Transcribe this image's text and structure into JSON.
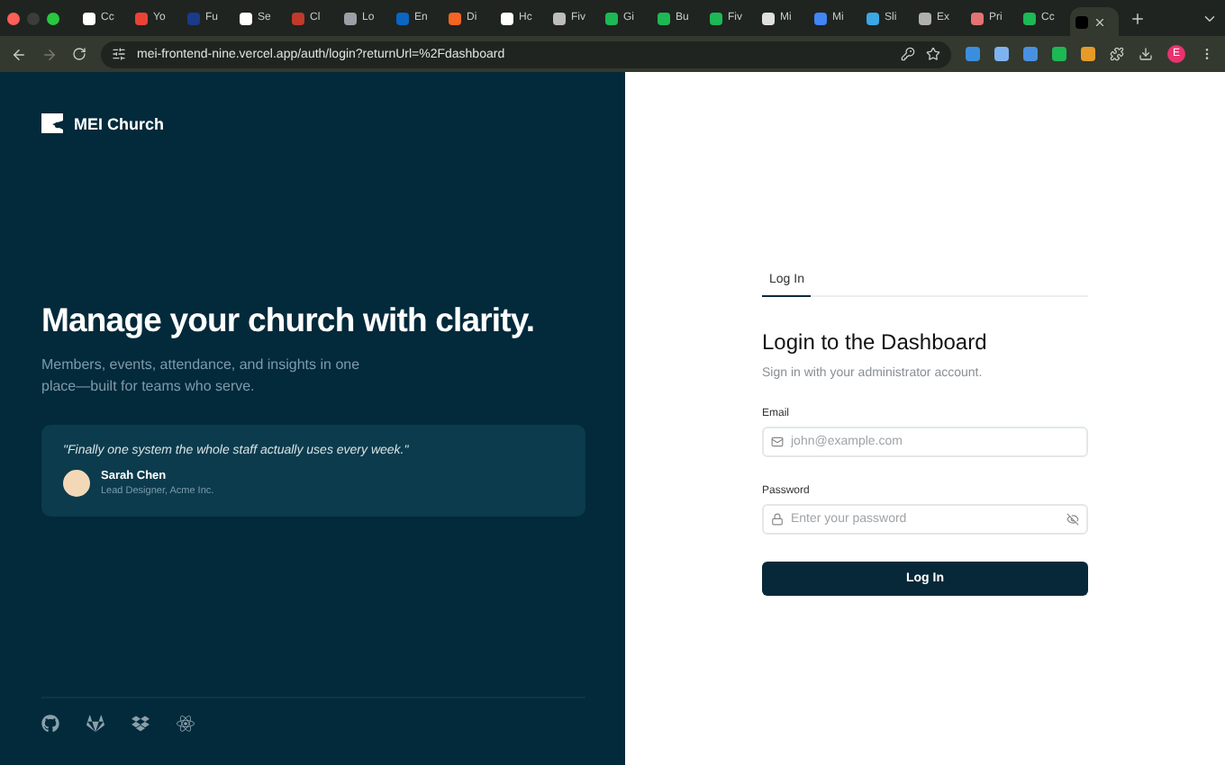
{
  "browser": {
    "tabs": [
      {
        "title": "Cc",
        "color": "#ffffff",
        "selected": false
      },
      {
        "title": "Yo",
        "color": "#ea4335",
        "selected": false
      },
      {
        "title": "Fu",
        "color": "#1a3a8a",
        "selected": false
      },
      {
        "title": "Se",
        "color": "#ffffff",
        "selected": false
      },
      {
        "title": "Cl",
        "color": "#c0392b",
        "selected": false
      },
      {
        "title": "Lo",
        "color": "#9aa0a6",
        "selected": false
      },
      {
        "title": "En",
        "color": "#0a66c2",
        "selected": false
      },
      {
        "title": "Di",
        "color": "#f26522",
        "selected": false
      },
      {
        "title": "Hc",
        "color": "#ffffff",
        "selected": false
      },
      {
        "title": "Fiv",
        "color": "#bdbdbd",
        "selected": false
      },
      {
        "title": "Gi",
        "color": "#1db954",
        "selected": false
      },
      {
        "title": "Bu",
        "color": "#1db954",
        "selected": false
      },
      {
        "title": "Fiv",
        "color": "#1db954",
        "selected": false
      },
      {
        "title": "Mi",
        "color": "#e0e0e0",
        "selected": false
      },
      {
        "title": "Mi",
        "color": "#4285f4",
        "selected": false
      },
      {
        "title": "Sli",
        "color": "#3ba7e5",
        "selected": false
      },
      {
        "title": "Ex",
        "color": "#b0b0b0",
        "selected": false
      },
      {
        "title": "Pri",
        "color": "#e57373",
        "selected": false
      },
      {
        "title": "Cc",
        "color": "#1db954",
        "selected": false
      },
      {
        "color": "#000000",
        "selected": true
      }
    ],
    "url": "mei-frontend-nine.vercel.app/auth/login?returnUrl=%2Fdashboard",
    "profile": "E"
  },
  "brand": {
    "name": "MEI Church"
  },
  "hero": {
    "title": "Manage your church with clarity.",
    "subtitle": "Members, events, attendance, and insights in one place—built for teams who serve."
  },
  "testimonial": {
    "quote": "\"Finally one system the whole staff actually uses every week.\"",
    "name": "Sarah Chen",
    "role": "Lead Designer, Acme Inc."
  },
  "login": {
    "tabs": [
      {
        "label": "Log In",
        "selected": true
      }
    ],
    "title": "Login to the Dashboard",
    "subtitle": "Sign in with your administrator account.",
    "fields": [
      {
        "kind": "email",
        "label": "Email",
        "placeholder": "john@example.com"
      },
      {
        "kind": "password",
        "label": "Password",
        "placeholder": "Enter your password"
      }
    ],
    "button": "Log In"
  }
}
